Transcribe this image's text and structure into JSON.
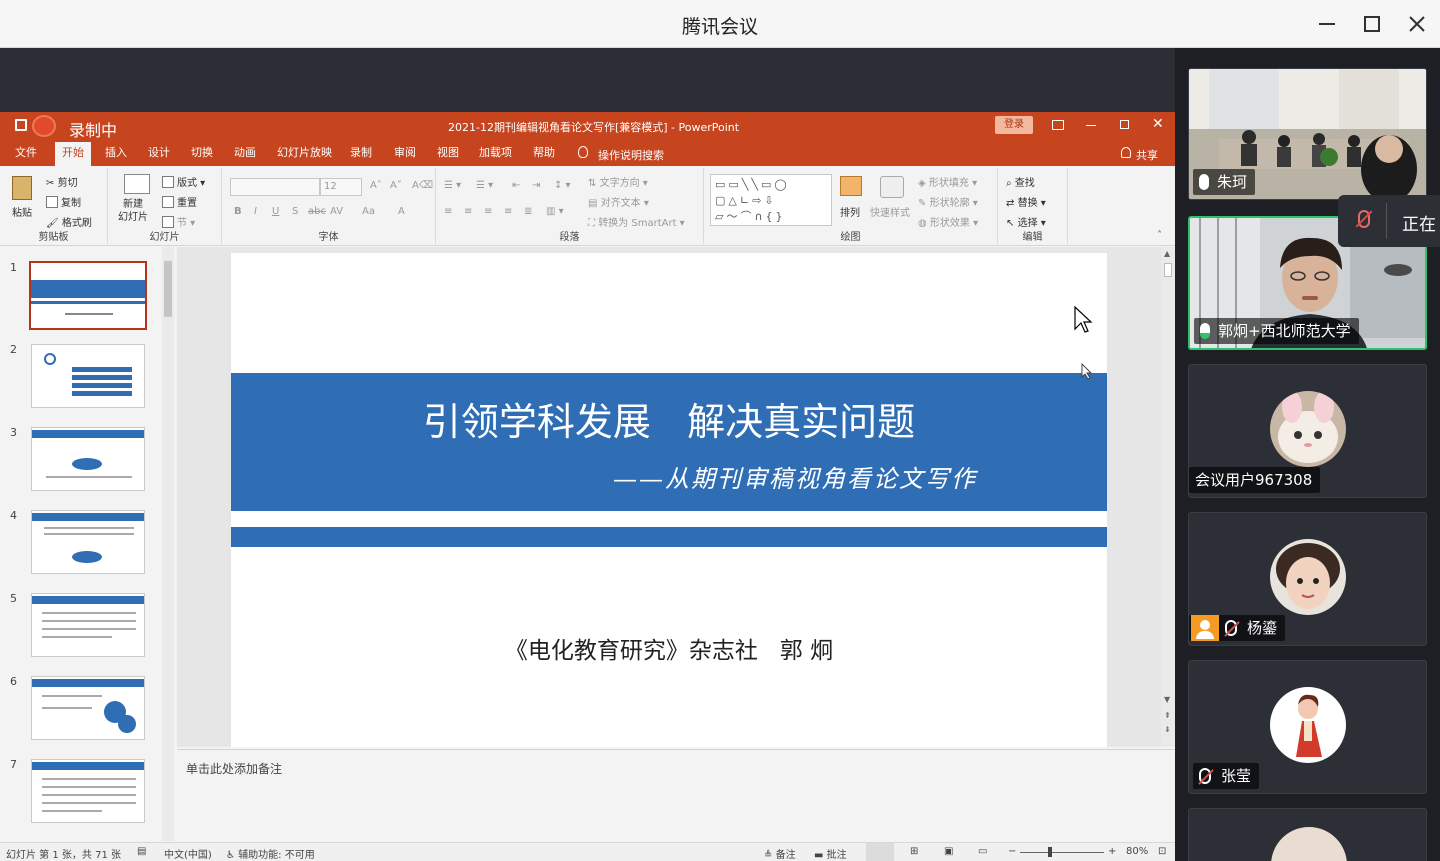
{
  "meeting": {
    "window_title": "腾讯会议",
    "controls": {
      "minimize": "minimize-icon",
      "maximize": "maximize-icon",
      "close": "close-icon"
    }
  },
  "ppt": {
    "recording_label": "录制中",
    "doc_title": "2021-12期刊编辑视角看论文写作[兼容模式]  -  PowerPoint",
    "login_label": "登录",
    "share_label": "共享",
    "menu_tabs": [
      "文件",
      "开始",
      "插入",
      "设计",
      "切换",
      "动画",
      "幻灯片放映",
      "录制",
      "审阅",
      "视图",
      "加载项",
      "帮助"
    ],
    "tell_me": "操作说明搜索",
    "ribbon": {
      "clipboard": {
        "paste": "粘贴",
        "cut": "剪切",
        "copy": "复制",
        "format_painter": "格式刷",
        "label": "剪贴板"
      },
      "slides": {
        "new_slide": "新建\n幻灯片",
        "layout": "版式",
        "reset": "重置",
        "section": "节",
        "label": "幻灯片"
      },
      "font": {
        "size": "12",
        "label": "字体"
      },
      "paragraph": {
        "text_direction": "文字方向",
        "align_text": "对齐文本",
        "smartart": "转换为 SmartArt",
        "label": "段落"
      },
      "drawing": {
        "arrange": "排列",
        "quick_styles": "快速样式",
        "fill": "形状填充",
        "outline": "形状轮廓",
        "effects": "形状效果",
        "label": "绘图"
      },
      "editing": {
        "find": "查找",
        "replace": "替换",
        "select": "选择",
        "label": "编辑"
      }
    },
    "thumbnail_numbers": [
      "1",
      "2",
      "3",
      "4",
      "5",
      "6",
      "7"
    ],
    "slide": {
      "title": "引领学科发展   解决真实问题",
      "subtitle": "——从期刊审稿视角看论文写作",
      "author": "《电化教育研究》杂志社   郭 炯"
    },
    "notes_placeholder": "单击此处添加备注",
    "status": {
      "slide_count": "幻灯片 第 1 张，共 71 张",
      "language": "中文(中国)",
      "accessibility": "辅助功能: 不可用",
      "notes": "备注",
      "comments": "批注",
      "zoom": "80%"
    },
    "colors": {
      "accent": "#c6451f",
      "slide_blue": "#2f6db5"
    }
  },
  "participants": [
    {
      "name": "朱珂",
      "mic": "mic-on"
    },
    {
      "name": "郭炯+西北师范大学",
      "mic": "mic-speaking",
      "active": true
    },
    {
      "name": "会议用户967308",
      "mic": "none"
    },
    {
      "name": "杨鎏",
      "mic": "mic-muted"
    },
    {
      "name": "张莹",
      "mic": "mic-muted"
    }
  ],
  "popup_text": "正在"
}
